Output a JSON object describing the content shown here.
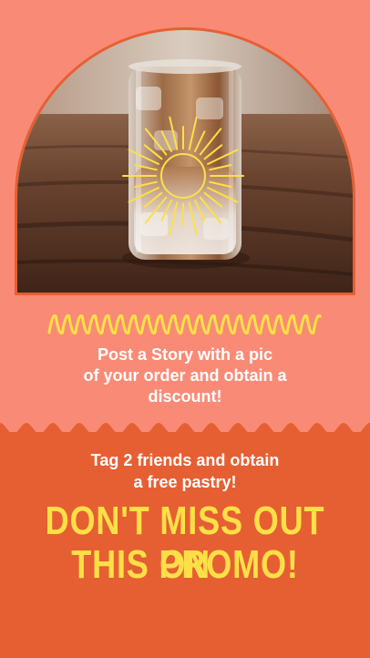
{
  "promo": {
    "instruction_lines": [
      "Post a Story with a pic",
      "of your order and obtain a",
      "discount!"
    ],
    "tag_lines": [
      "Tag 2 friends and obtain",
      "a free pastry!"
    ],
    "headline_lines": [
      "DON'T MISS OUT ON",
      "THIS PROMO!"
    ]
  },
  "photo": {
    "subject": "iced-coffee-glass"
  },
  "colors": {
    "background": "#f98b76",
    "panel": "#e65f33",
    "accent_yellow": "#fde047",
    "text_white": "#ffffff"
  }
}
